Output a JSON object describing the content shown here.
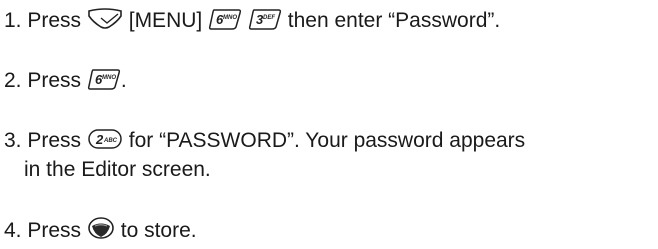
{
  "steps": [
    {
      "number": "1.",
      "text_a": "Press",
      "key_menu_label": "[MENU]",
      "text_b": "then enter “Password”."
    },
    {
      "number": "2.",
      "text_a": "Press",
      "text_b": "."
    },
    {
      "number": "3.",
      "text_a": "Press",
      "text_b": "for “PASSWORD”. Your password appears",
      "text_c": "in the Editor screen."
    },
    {
      "number": "4.",
      "text_a": "Press",
      "text_b": "to store."
    }
  ],
  "keys": {
    "six": {
      "digit": "6",
      "letters": "MNO"
    },
    "three": {
      "digit": "3",
      "letters": "DEF"
    },
    "two": {
      "digit": "2",
      "letters": "ABC"
    }
  },
  "icons": {
    "menu_softkey": "menu-softkey-icon",
    "ok_key": "ok-key-icon"
  }
}
